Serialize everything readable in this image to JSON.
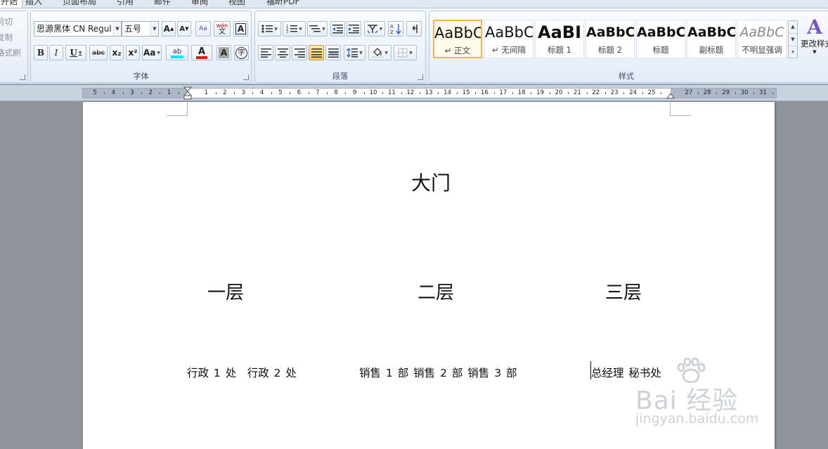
{
  "tabs": [
    "开始",
    "插入",
    "页面布局",
    "引用",
    "邮件",
    "审阅",
    "视图",
    "福昕PDF"
  ],
  "clipboard": {
    "cut": "剪切",
    "copy": "复制",
    "format_painter": "格式刷"
  },
  "font_group": {
    "label": "字体",
    "font_name": "思源黑体 CN Regul",
    "font_size": "五号",
    "grow": "A",
    "shrink": "A",
    "clear": "Aa",
    "phonetic": "wén",
    "char_border": "A",
    "bold": "B",
    "italic": "I",
    "underline": "U",
    "strike": "abc",
    "subscript": "x₂",
    "superscript": "x²",
    "change_case": "Aa",
    "highlight": "ab",
    "font_color": "A",
    "char_shading": "A",
    "enclose": "字",
    "highlight_color": "#00e8ff",
    "font_color_value": "#e3170d"
  },
  "paragraph_group": {
    "label": "段落"
  },
  "styles_group": {
    "label": "样式",
    "items": [
      {
        "sample": "AaBbC",
        "name": "↵ 正文"
      },
      {
        "sample": "AaBbC",
        "name": "↵ 无间隔"
      },
      {
        "sample": "AaBI",
        "name": "标题 1"
      },
      {
        "sample": "AaBbC",
        "name": "标题 2"
      },
      {
        "sample": "AaBbC",
        "name": "标题"
      },
      {
        "sample": "AaBbC",
        "name": "副标题"
      },
      {
        "sample": "AaBbC",
        "name": "不明显强调"
      }
    ],
    "change_styles": "更改样式"
  },
  "ruler_numbers": [
    "5",
    "4",
    "3",
    "2",
    "1",
    "1",
    "2",
    "3",
    "4",
    "5",
    "6",
    "7",
    "8",
    "9",
    "10",
    "11",
    "12",
    "13",
    "14",
    "15",
    "16",
    "17",
    "18",
    "19",
    "20",
    "21",
    "22",
    "23",
    "24",
    "25",
    "27",
    "28",
    "29",
    "30",
    "31"
  ],
  "document": {
    "title": "大门",
    "floors": [
      "一层",
      "二层",
      "三层"
    ],
    "departments": [
      "行政 1 处　行政 2 处",
      "销售 1 部  销售 2 部  销售 3 部",
      "总经理  秘书处"
    ]
  },
  "watermark": {
    "text": "Bai 经验",
    "url": "jingyan.baidu.com"
  }
}
